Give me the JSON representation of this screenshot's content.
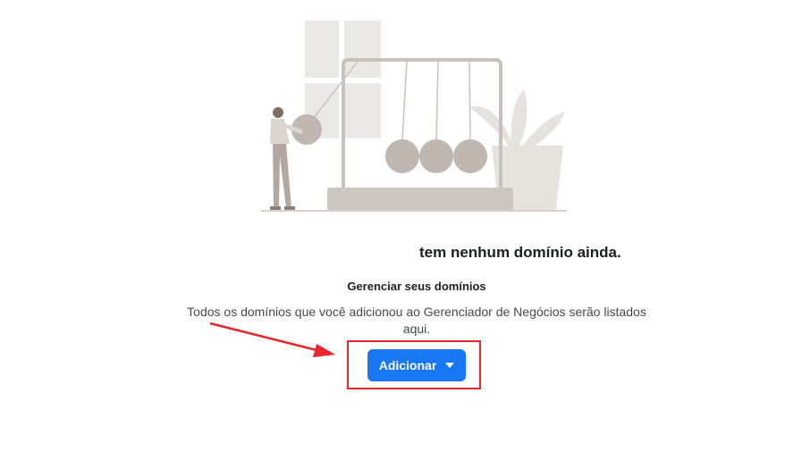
{
  "empty_state": {
    "title": "tem nenhum domínio ainda.",
    "heading": "Gerenciar seus domínios",
    "description": "Todos os domínios que você adicionou ao Gerenciador de Negócios serão listados aqui."
  },
  "actions": {
    "add_label": "Adicionar",
    "add_icon": "caret-down-icon"
  },
  "annotation": {
    "arrow_color": "#e8262b",
    "box_color": "#e8262b"
  },
  "colors": {
    "primary": "#1877f2",
    "illustration": "#c9c2bb"
  }
}
